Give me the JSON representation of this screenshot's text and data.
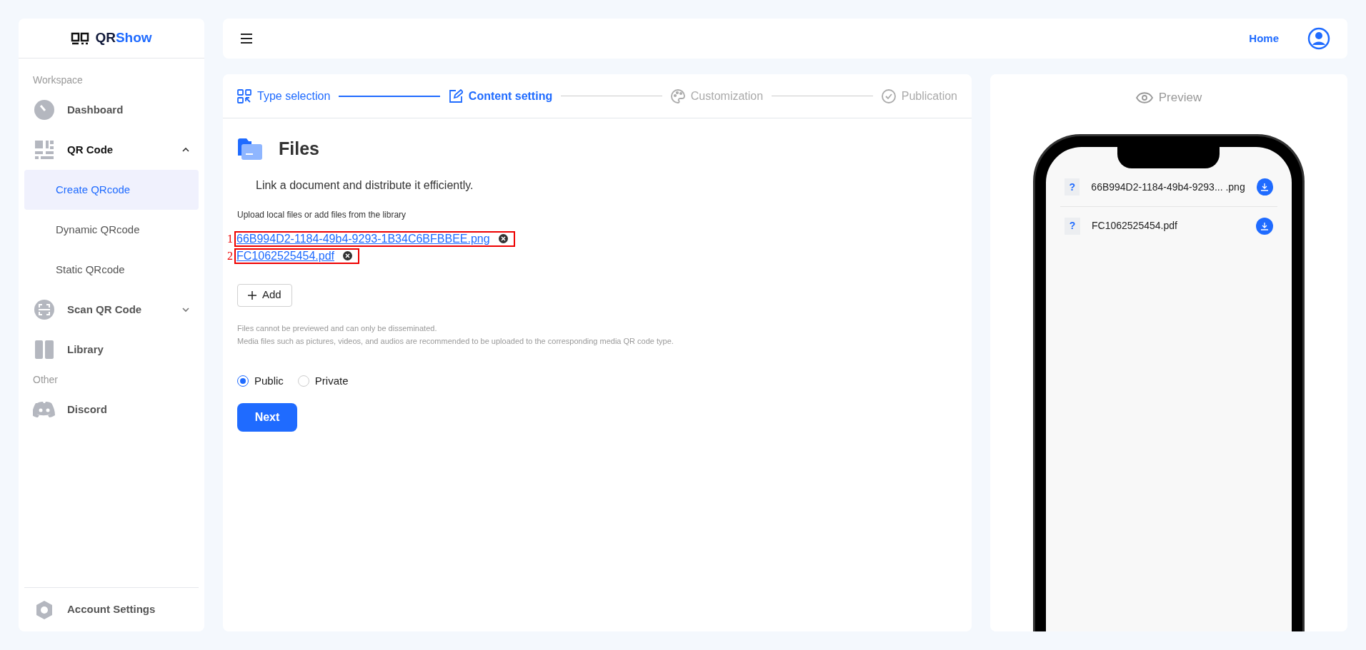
{
  "brand": {
    "prefix": "QR",
    "suffix": "Show"
  },
  "sidebar": {
    "sections": [
      {
        "heading": "Workspace",
        "items": [
          {
            "label": "Dashboard"
          },
          {
            "label": "QR Code",
            "expanded": true,
            "children": [
              {
                "label": "Create QRcode",
                "selected": true
              },
              {
                "label": "Dynamic QRcode",
                "selected": false
              },
              {
                "label": "Static QRcode",
                "selected": false
              }
            ]
          },
          {
            "label": "Scan QR Code",
            "expanded": false
          },
          {
            "label": "Library"
          }
        ]
      },
      {
        "heading": "Other",
        "items": [
          {
            "label": "Discord"
          }
        ]
      }
    ],
    "footer": "Account Settings"
  },
  "topbar": {
    "home_link": "Home"
  },
  "steps": [
    {
      "label": "Type selection",
      "done": true,
      "selected": false
    },
    {
      "label": "Content setting",
      "done": false,
      "selected": true
    },
    {
      "label": "Customization",
      "done": false,
      "selected": false
    },
    {
      "label": "Publication",
      "done": false,
      "selected": false
    }
  ],
  "form": {
    "title": "Files",
    "description": "Link a document and distribute it efficiently.",
    "upload_label": "Upload local files or add files from the library",
    "files": [
      {
        "name": "66B994D2-1184-49b4-9293-1B34C6BFBBEE.png",
        "marker": "1"
      },
      {
        "name": "FC1062525454.pdf",
        "marker": "2"
      }
    ],
    "add_button": "Add",
    "notes": [
      "Files cannot be previewed and can only be disseminated.",
      "Media files such as pictures, videos, and audios are recommended to be uploaded to the corresponding media QR code type."
    ],
    "visibility": [
      {
        "label": "Public",
        "selected": true
      },
      {
        "label": "Private",
        "selected": false
      }
    ],
    "next_button": "Next"
  },
  "preview": {
    "title": "Preview",
    "files": [
      {
        "badge": "?",
        "name": "66B994D2-1184-49b4-9293... .png"
      },
      {
        "badge": "?",
        "name": "FC1062525454.pdf"
      }
    ]
  }
}
